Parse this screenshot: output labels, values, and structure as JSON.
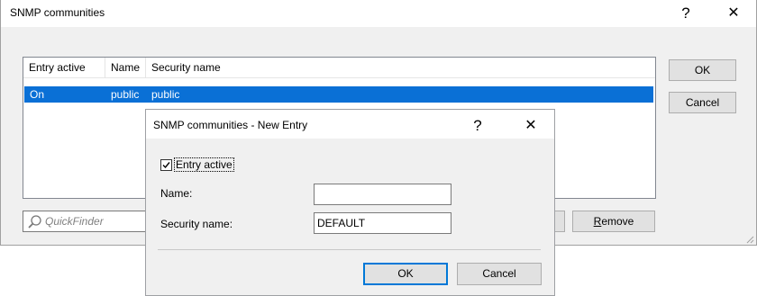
{
  "window": {
    "title": "SNMP communities",
    "help_glyph": "?",
    "close_glyph": "✕"
  },
  "table": {
    "columns": [
      "Entry active",
      "Name",
      "Security name"
    ],
    "rows": [
      {
        "entry_active": "On",
        "name": "public",
        "security_name": "public"
      }
    ]
  },
  "buttons": {
    "ok": "OK",
    "cancel": "Cancel",
    "remove_first": "R",
    "remove_rest": "emove"
  },
  "quickfinder": {
    "placeholder": "QuickFinder"
  },
  "dialog": {
    "title": "SNMP communities - New Entry",
    "help_glyph": "?",
    "close_glyph": "✕",
    "entry_active_label": "Entry active",
    "entry_active_checked": true,
    "name_label": "Name:",
    "name_value": "",
    "security_name_label": "Security name:",
    "security_name_value": "DEFAULT",
    "ok": "OK",
    "cancel": "Cancel"
  }
}
